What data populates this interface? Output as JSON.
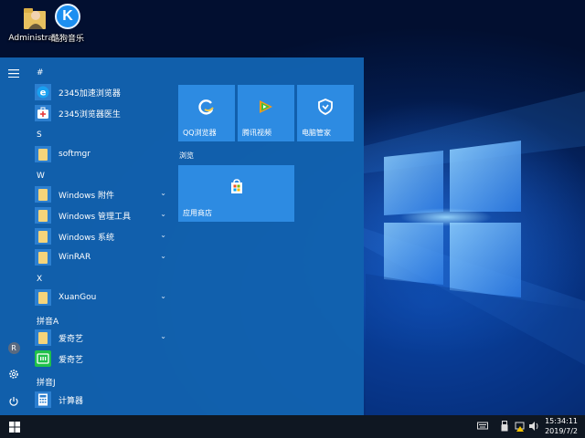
{
  "desktop": {
    "icons": [
      {
        "label": "Administra..."
      },
      {
        "label": "酷狗音乐",
        "glyph": "K"
      }
    ]
  },
  "start_menu": {
    "rail": {
      "avatar_initial": "R"
    },
    "groups": [
      {
        "header": "#",
        "items": [
          {
            "label": "2345加速浏览器",
            "icon": "browser-e-icon"
          },
          {
            "label": "2345浏览器医生",
            "icon": "medkit-icon"
          }
        ]
      },
      {
        "header": "S",
        "items": [
          {
            "label": "softmgr",
            "icon": "folder-icon"
          }
        ]
      },
      {
        "header": "W",
        "items": [
          {
            "label": "Windows 附件",
            "icon": "folder-icon",
            "expandable": true
          },
          {
            "label": "Windows 管理工具",
            "icon": "folder-icon",
            "expandable": true
          },
          {
            "label": "Windows 系统",
            "icon": "folder-icon",
            "expandable": true
          },
          {
            "label": "WinRAR",
            "icon": "folder-icon",
            "expandable": true
          }
        ]
      },
      {
        "header": "X",
        "items": [
          {
            "label": "XuanGou",
            "icon": "folder-icon",
            "expandable": true
          }
        ]
      },
      {
        "header": "拼音A",
        "items": [
          {
            "label": "爱奇艺",
            "icon": "folder-icon",
            "expandable": true
          },
          {
            "label": "爱奇艺",
            "icon": "iqiyi-icon"
          }
        ]
      },
      {
        "header": "拼音J",
        "items": [
          {
            "label": "计算器",
            "icon": "calculator-icon"
          }
        ]
      }
    ],
    "tiles": [
      {
        "label": "QQ浏览器",
        "icon": "qq-browser-icon"
      },
      {
        "label": "腾讯视频",
        "icon": "tencent-video-icon"
      },
      {
        "label": "电脑管家",
        "icon": "pc-manager-icon"
      }
    ],
    "tile_group_label": "浏览",
    "store_tile": {
      "label": "应用商店",
      "icon": "store-icon"
    }
  },
  "taskbar": {
    "time": "15:34:11",
    "date": "2019/7/2"
  },
  "colors": {
    "menu_bg": "#1262b0",
    "tile_bg": "#2d8be2",
    "taskbar_bg": "#0f1722"
  }
}
